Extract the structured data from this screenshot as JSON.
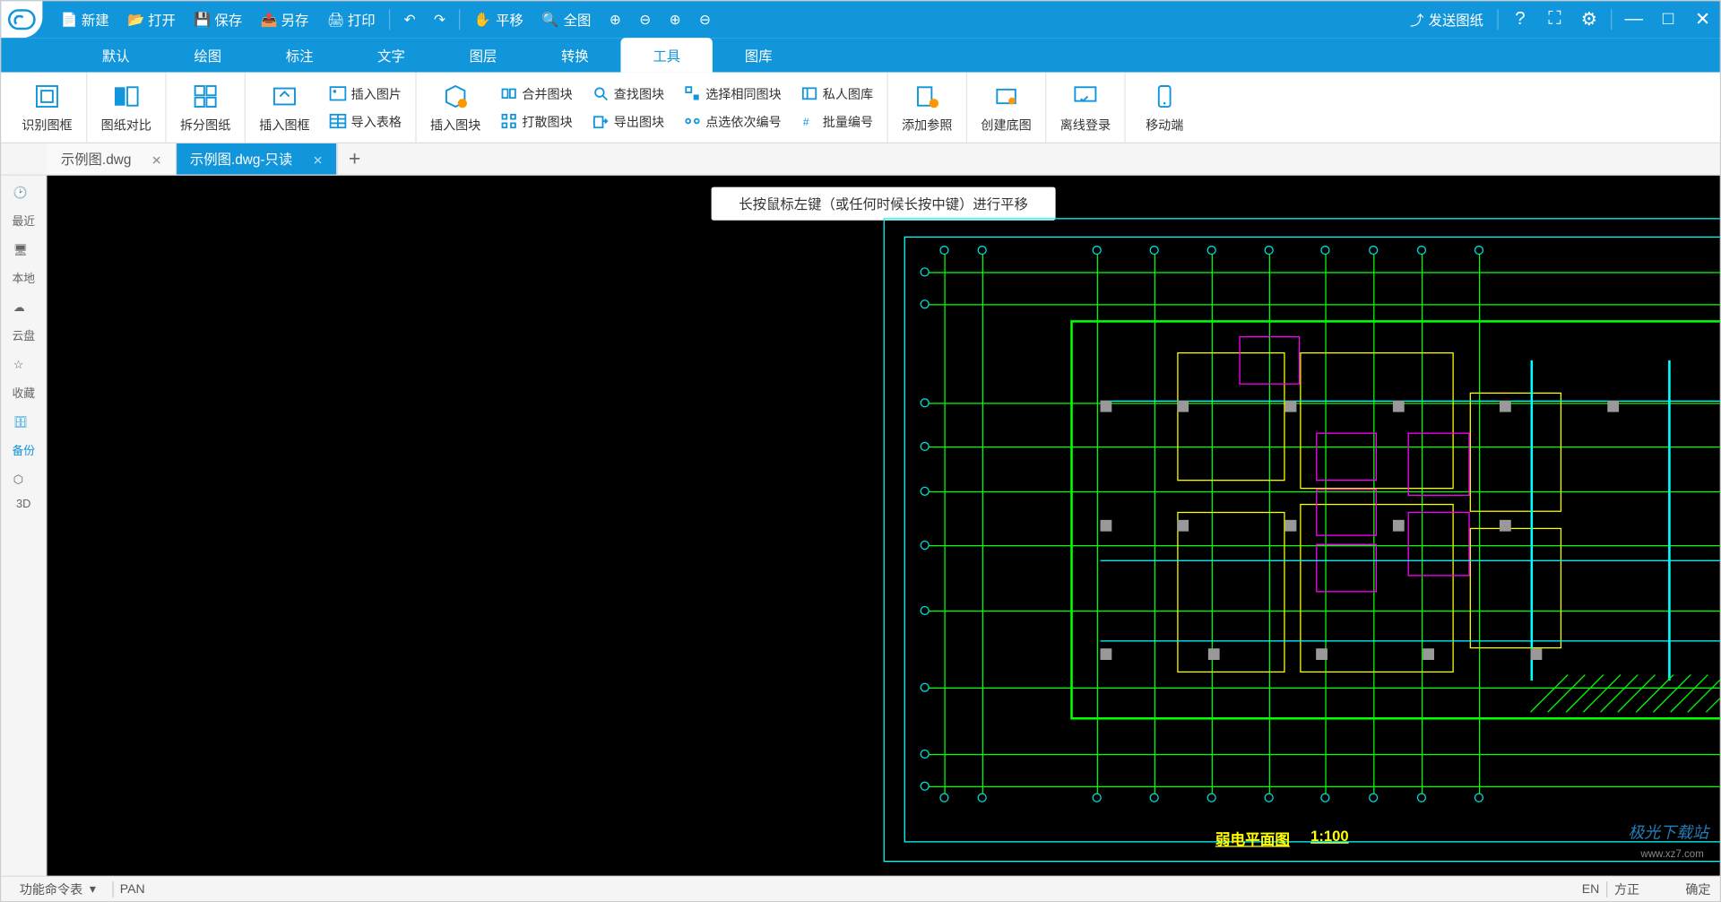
{
  "titlebar": {
    "new": "新建",
    "open": "打开",
    "save": "保存",
    "saveas": "另存",
    "print": "打印",
    "pan": "平移",
    "fit": "全图",
    "send": "发送图纸"
  },
  "menu": {
    "tabs": [
      "默认",
      "绘图",
      "标注",
      "文字",
      "图层",
      "转换",
      "工具",
      "图库"
    ],
    "active": 6
  },
  "ribbon": {
    "recognize_frame": "识别图框",
    "compare": "图纸对比",
    "split": "拆分图纸",
    "insert_frame": "插入图框",
    "insert_image": "插入图片",
    "import_table": "导入表格",
    "insert_block": "插入图块",
    "merge_block": "合并图块",
    "explode_block": "打散图块",
    "find_block": "查找图块",
    "export_block": "导出图块",
    "select_same": "选择相同图块",
    "click_number": "点选依次编号",
    "private_lib": "私人图库",
    "batch_number": "批量编号",
    "add_ref": "添加参照",
    "create_base": "创建底图",
    "offline_login": "离线登录",
    "mobile": "移动端"
  },
  "tabs": {
    "items": [
      {
        "label": "示例图.dwg",
        "active": false
      },
      {
        "label": "示例图.dwg-只读",
        "active": true
      }
    ]
  },
  "sidebar": {
    "items": [
      "最近",
      "本地",
      "云盘",
      "收藏",
      "备份",
      "3D"
    ]
  },
  "canvas": {
    "tooltip": "长按鼠标左键（或任何时候长按中键）进行平移",
    "title": "弱电平面图",
    "scale": "1:100"
  },
  "status": {
    "cmd_table": "功能命令表",
    "cmd": "PAN",
    "lang": "EN",
    "full": "方正",
    "confirm": "确定"
  },
  "watermark": "极光下载站",
  "watermark_url": "www.xz7.com"
}
